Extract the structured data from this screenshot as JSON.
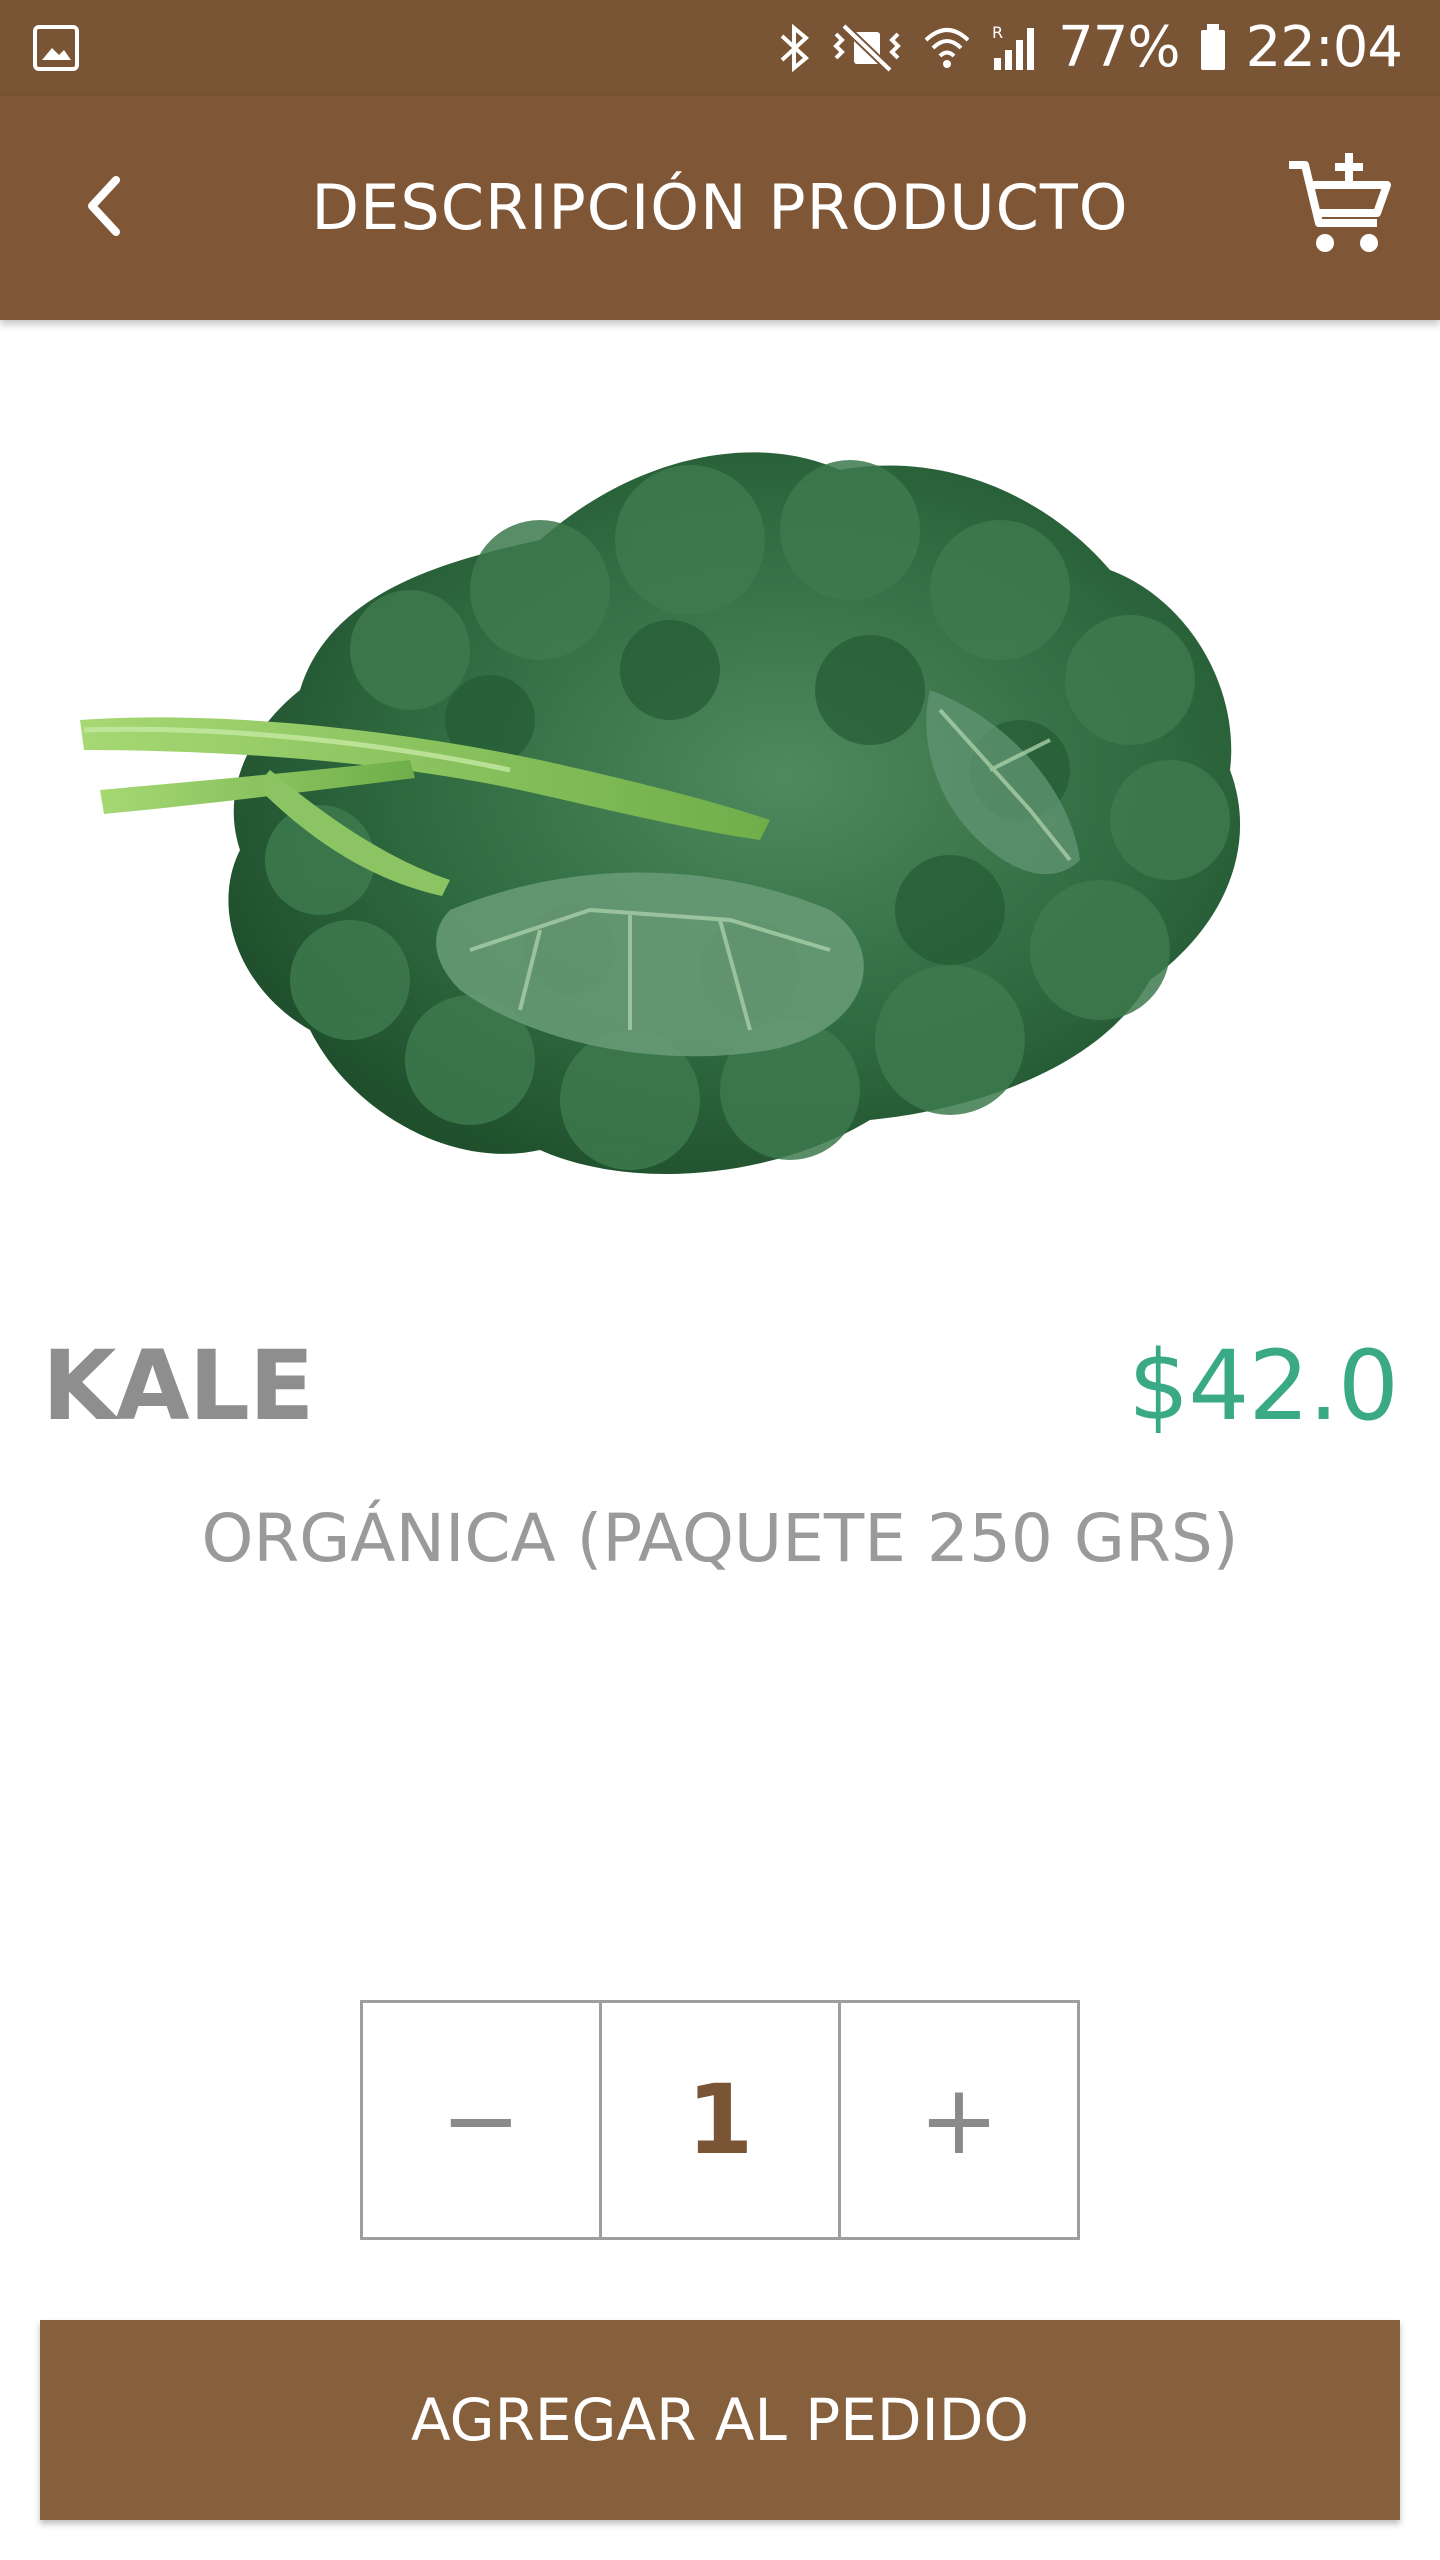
{
  "status_bar": {
    "battery": "77%",
    "time": "22:04",
    "icons": [
      "gallery-icon",
      "bluetooth-icon",
      "vibrate-icon",
      "wifi-icon",
      "signal-icon",
      "battery-icon"
    ]
  },
  "app_bar": {
    "title": "DESCRIPCIÓN PRODUCTO",
    "back_icon": "chevron-left-icon",
    "cart_icon": "cart-plus-icon"
  },
  "product": {
    "image": "kale-leaf-image",
    "name": "KALE",
    "price": "$42.0",
    "description": "ORGÁNICA (PAQUETE 250 GRS)"
  },
  "stepper": {
    "minus": "−",
    "value": "1",
    "plus": "+"
  },
  "add_button": {
    "label": "AGREGAR AL PEDIDO"
  },
  "colors": {
    "brand_brown": "#7f5736",
    "price_green": "#3aaa86",
    "text_gray": "#8e8e8e"
  }
}
